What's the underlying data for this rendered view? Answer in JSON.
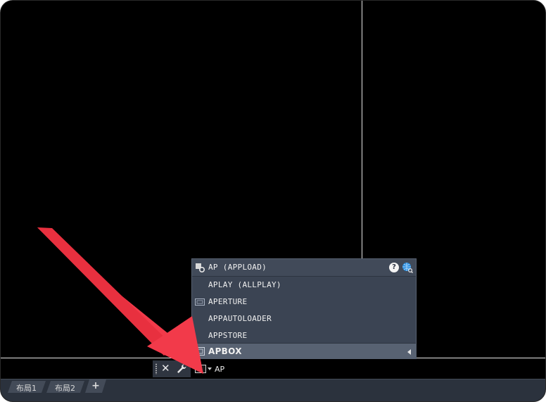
{
  "autocomplete": {
    "items": [
      {
        "label": "AP (APPLOAD)",
        "icon": "appload-gear-icon",
        "type": "header"
      },
      {
        "label": "APLAY (ALLPLAY)",
        "icon": "",
        "type": "item"
      },
      {
        "label": "APERTURE",
        "icon": "aperture-icon",
        "type": "item"
      },
      {
        "label": "APPAUTOLOADER",
        "icon": "",
        "type": "item"
      },
      {
        "label": "APPSTORE",
        "icon": "",
        "type": "item"
      },
      {
        "label": "APBOX",
        "icon": "apbox-icon",
        "type": "selected"
      }
    ],
    "help_glyph": "?"
  },
  "command_line": {
    "input_value": "AP",
    "close_glyph": "✕"
  },
  "layout_tabs": [
    "布局1",
    "布局2"
  ],
  "add_tab_glyph": "+",
  "colors": {
    "background": "#000000",
    "popup": "#3b4453",
    "popup_selected": "#586272",
    "tabbar": "#2b323d",
    "arrow": "#f23a4a"
  }
}
